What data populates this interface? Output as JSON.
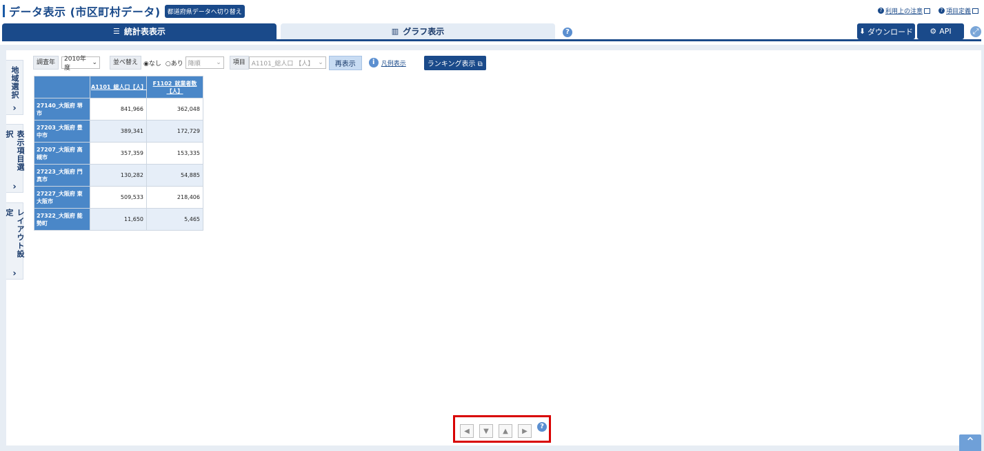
{
  "header": {
    "title": "データ表示 (市区町村データ)",
    "switch_button": "都道府県データへ切り替え",
    "links": [
      "利用上の注意",
      "項目定義"
    ]
  },
  "tabs": [
    {
      "label": "統計表表示",
      "icon": "table-icon",
      "active": true
    },
    {
      "label": "グラフ表示",
      "icon": "bar-chart-icon",
      "active": false
    }
  ],
  "actions": {
    "download": "ダウンロード",
    "api": "API"
  },
  "side_tabs": [
    "地域選択",
    "表示項目選択",
    "レイアウト設定"
  ],
  "toolbar": {
    "year_label": "調査年",
    "year_value": "2010年度",
    "sort_label": "並べ替え",
    "radio_none": "◉なし",
    "radio_yes": "○あり",
    "order_value": "降順",
    "item_label": "項目",
    "item_value": "A1101_総人口 【人】",
    "rerun": "再表示",
    "legend": "凡例表示",
    "ranking": "ランキング表示"
  },
  "table": {
    "columns": [
      "A1101_総人口【人】",
      "F1102_就業者数【人】"
    ],
    "rows": [
      {
        "label": "27140_大阪府 堺市",
        "values": [
          "841,966",
          "362,048"
        ]
      },
      {
        "label": "27203_大阪府 豊中市",
        "values": [
          "389,341",
          "172,729"
        ]
      },
      {
        "label": "27207_大阪府 高槻市",
        "values": [
          "357,359",
          "153,335"
        ]
      },
      {
        "label": "27223_大阪府 門真市",
        "values": [
          "130,282",
          "54,885"
        ]
      },
      {
        "label": "27227_大阪府 東大阪市",
        "values": [
          "509,533",
          "218,406"
        ]
      },
      {
        "label": "27322_大阪府 能勢町",
        "values": [
          "11,650",
          "5,465"
        ]
      }
    ]
  },
  "nav": {
    "left": "◀",
    "down": "▼",
    "up": "▲",
    "right": "▶",
    "help": "?"
  }
}
